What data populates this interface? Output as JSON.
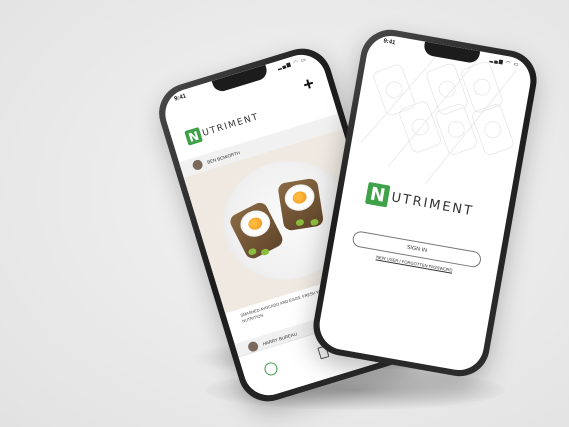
{
  "feed_phone": {
    "time": "9:41",
    "brand_initial": "N",
    "brand_rest": "UTRIMENT",
    "add_label": "+",
    "posts": [
      {
        "author": "BEN BOWORTH",
        "caption": "SMASHED AVOCADO AND EGGS. FRESH WITH LOTS OF GOOD NUTRITION."
      },
      {
        "author": "HARRY BUREAU"
      }
    ],
    "tabs": [
      {
        "icon": "home-icon"
      },
      {
        "icon": "document-icon"
      },
      {
        "icon": "profile-icon"
      }
    ]
  },
  "login_phone": {
    "time": "9:41",
    "brand_initial": "N",
    "brand_rest": "UTRIMENT",
    "sign_in_label": "SIGN IN",
    "new_user_link": "NEW USER / FORGOTTEN PASSWORD"
  },
  "colors": {
    "brand_green": "#3fa14a",
    "background": "#ececec"
  }
}
